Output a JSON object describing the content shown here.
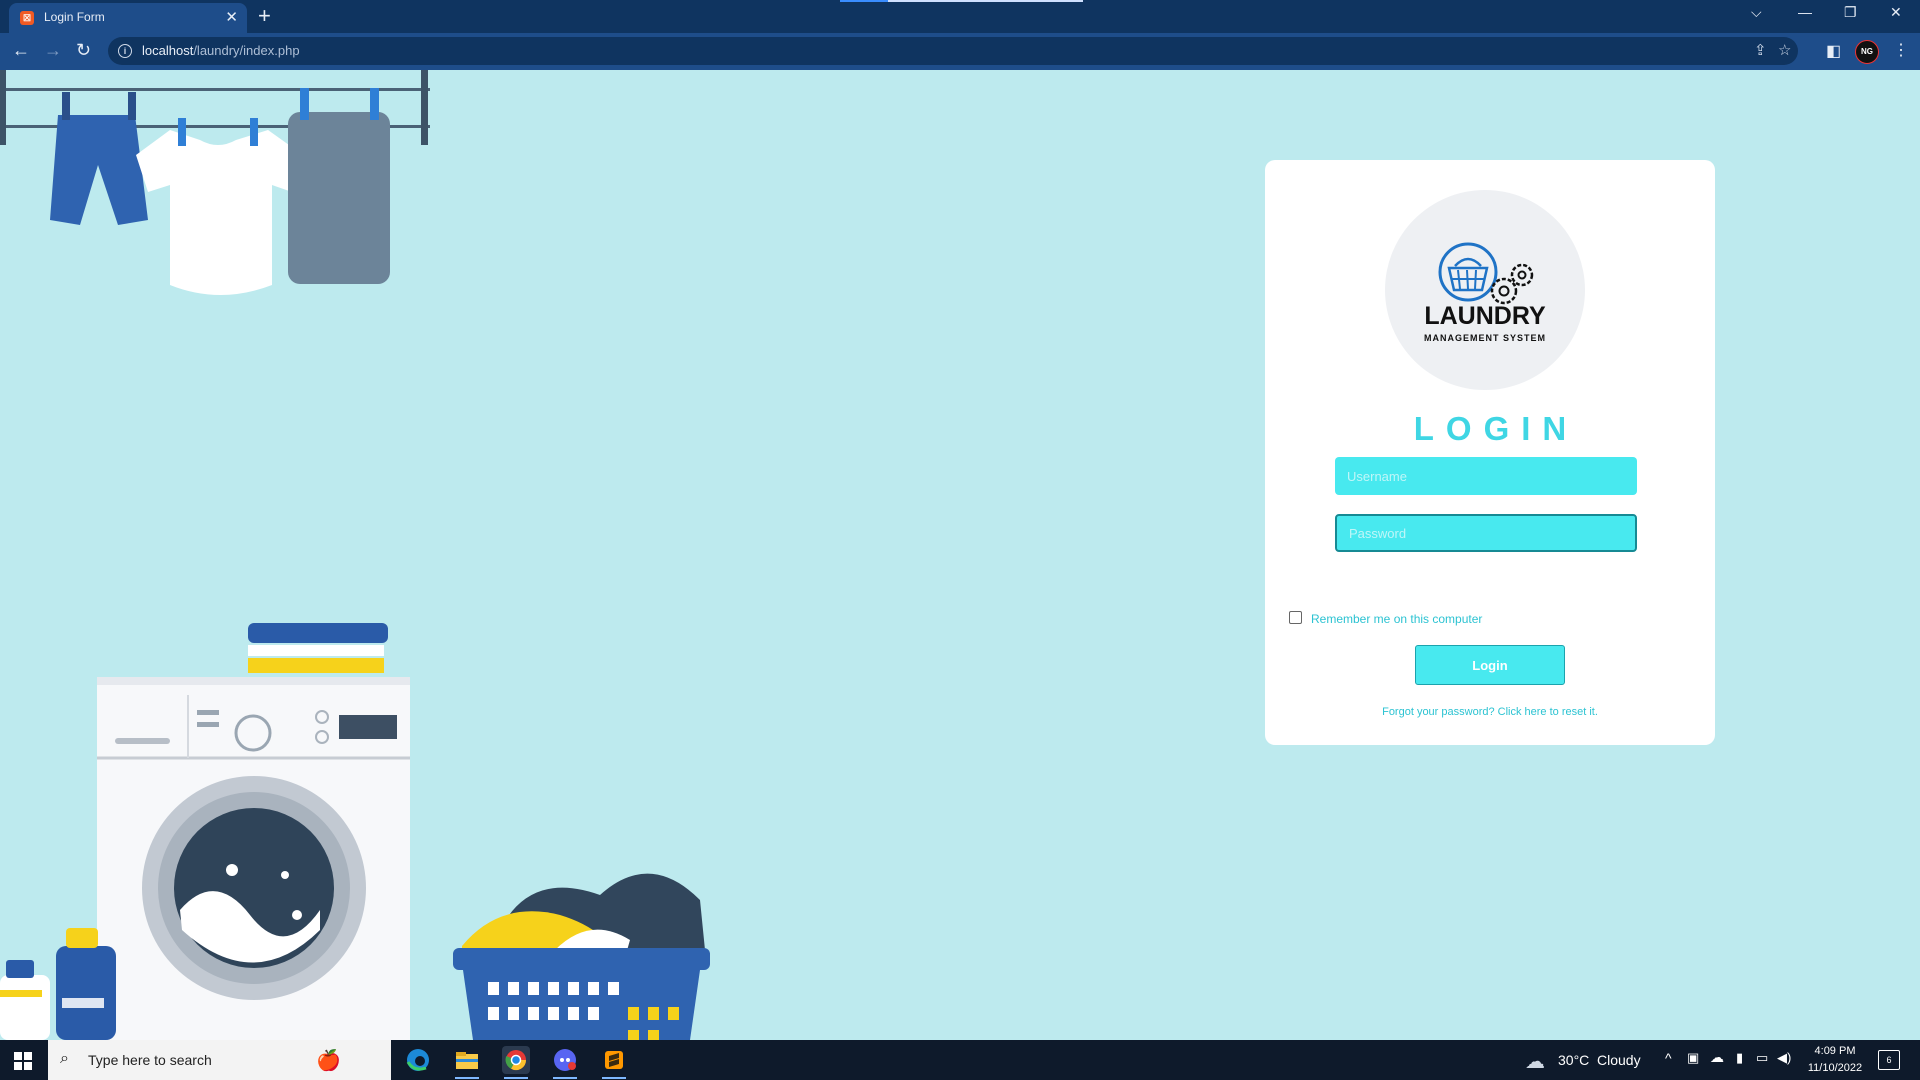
{
  "browser": {
    "tab_title": "Login Form",
    "tab_close": "✕",
    "new_tab": "+",
    "url_host": "localhost",
    "url_path": "/laundry/index.php",
    "profile_initials": "NG"
  },
  "login": {
    "logo_title": "LAUNDRY",
    "logo_subtitle": "MANAGEMENT SYSTEM",
    "heading": "LOGIN",
    "username_placeholder": "Username",
    "password_placeholder": "Password",
    "remember_label": "Remember me on this computer",
    "login_button": "Login",
    "forgot_link": "Forgot your password? Click here to reset it."
  },
  "taskbar": {
    "search_placeholder": "Type here to search",
    "weather_temp": "30°C",
    "weather_text": "Cloudy",
    "time": "4:09 PM",
    "date": "11/10/2022",
    "notification_count": "6"
  },
  "colors": {
    "page_background": "#bdeaee",
    "accent_cyan": "#48e9ef",
    "heading_cyan": "#3fd6e4",
    "browser_frame": "#0f3460",
    "browser_toolbar": "#1e4d8a"
  }
}
